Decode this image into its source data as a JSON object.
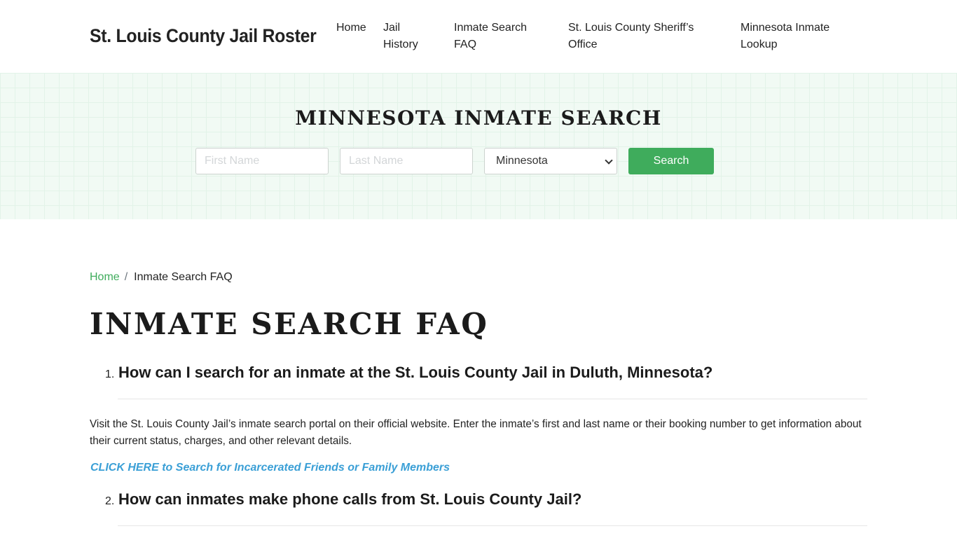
{
  "header": {
    "brand": "St. Louis County Jail Roster",
    "nav": [
      {
        "label": "Home"
      },
      {
        "label": "Jail History"
      },
      {
        "label": "Inmate Search FAQ"
      },
      {
        "label": "St. Louis County Sheriff’s Office"
      },
      {
        "label": "Minnesota Inmate Lookup"
      }
    ]
  },
  "search": {
    "title": "MINNESOTA INMATE SEARCH",
    "first_name_placeholder": "First Name",
    "last_name_placeholder": "Last Name",
    "state_selected": "Minnesota",
    "button_label": "Search"
  },
  "breadcrumb": {
    "home": "Home",
    "separator": "/",
    "current": "Inmate Search FAQ"
  },
  "page": {
    "title": "INMATE SEARCH FAQ",
    "faq": [
      {
        "number": "1.",
        "question": "How can I search for an inmate at the St. Louis County Jail in Duluth, Minnesota?",
        "answer": "Visit the St. Louis County Jail’s inmate search portal on their official website. Enter the inmate’s first and last name or their booking number to get information about their current status, charges, and other relevant details.",
        "cta": "CLICK HERE to Search for Incarcerated Friends or Family Members"
      },
      {
        "number": "2.",
        "question": "How can inmates make phone calls from St. Louis County Jail?"
      }
    ]
  },
  "colors": {
    "accent": "#3fac5c",
    "link": "#3a9fd6",
    "hero_bg": "#f1faf4"
  },
  "icons": {
    "select_arrow": "chevron-down-icon"
  }
}
